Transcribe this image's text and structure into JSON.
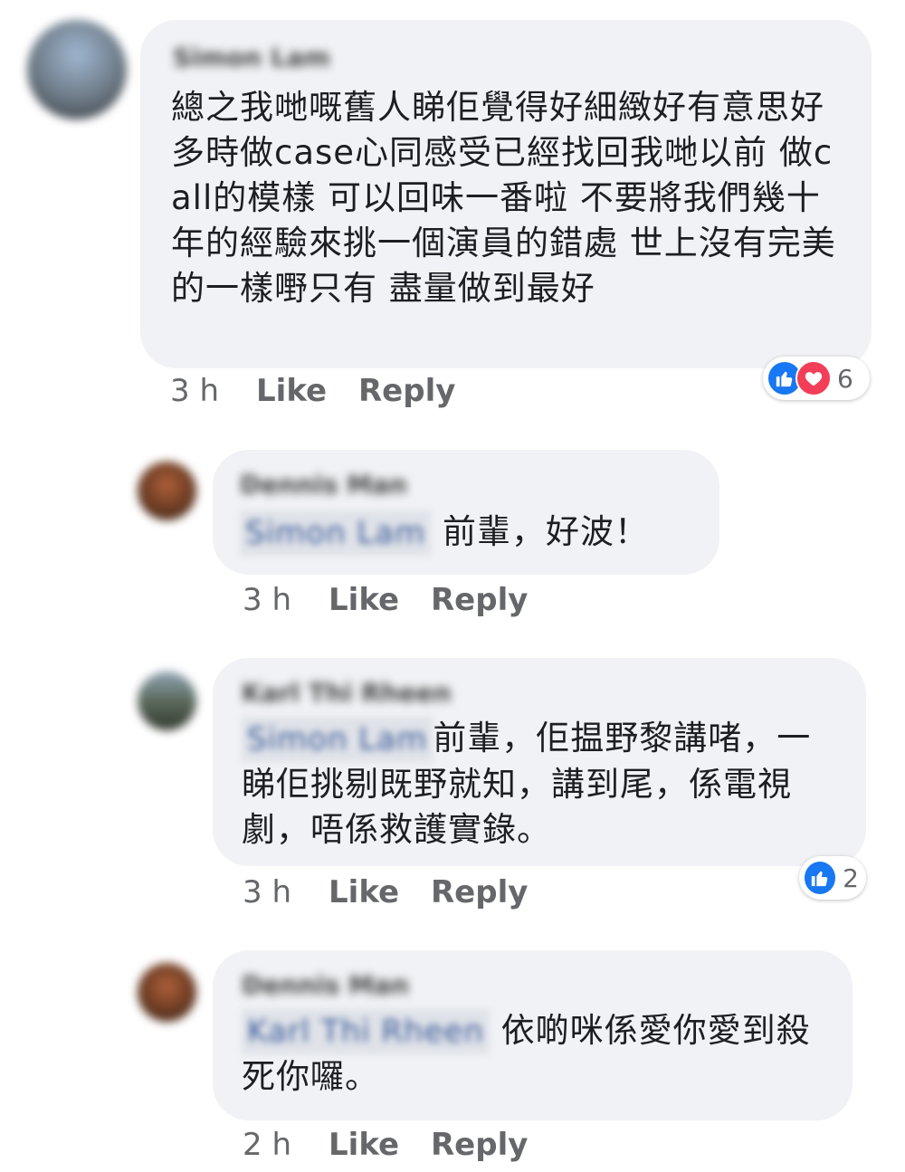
{
  "comments": [
    {
      "author": "Simon Lam",
      "mention": "",
      "text": "總之我哋嘅舊人睇佢覺得好細緻好有意思好多時做case心同感受已經找回我哋以前 做call的模樣 可以回味一番啦  不要將我們幾十年的經驗來挑一個演員的錯處   世上沒有完美的一樣嘢只有 盡量做到最好",
      "time": "3 h",
      "like_label": "Like",
      "reply_label": "Reply",
      "reaction_count": "6"
    },
    {
      "author": "Dennis Man",
      "mention": "Simon Lam",
      "text": "前輩，好波！",
      "time": "3 h",
      "like_label": "Like",
      "reply_label": "Reply"
    },
    {
      "author": "Karl Thi Rheen",
      "mention": "Simon Lam",
      "text": "前輩，佢揾野黎講啫，一睇佢挑剔既野就知，講到尾，係電視劇，唔係救護實錄。",
      "time": "3 h",
      "like_label": "Like",
      "reply_label": "Reply",
      "reaction_count": "2"
    },
    {
      "author": "Dennis Man",
      "mention": "Karl Thi Rheen",
      "text": "依啲咪係愛你愛到殺死你囉。",
      "time": "2 h",
      "like_label": "Like",
      "reply_label": "Reply"
    }
  ],
  "colors": {
    "bubble": "#f0f2f5",
    "like_blue": "#1877f2",
    "love_red": "#f33e58",
    "meta_gray": "#65676b"
  }
}
